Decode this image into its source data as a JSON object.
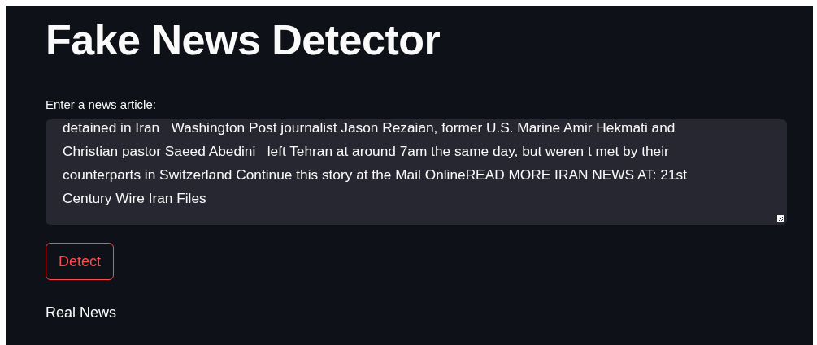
{
  "title": "Fake News Detector",
  "article_field": {
    "label": "Enter a news article:",
    "value": "detained in Iran   Washington Post journalist Jason Rezaian, former U.S. Marine Amir Hekmati and\nChristian pastor Saeed Abedini   left Tehran at around 7am the same day, but weren t met by their\ncounterparts in Switzerland Continue this story at the Mail OnlineREAD MORE IRAN NEWS AT: 21st\nCentury Wire Iran Files"
  },
  "detect_button": {
    "label": "Detect"
  },
  "result": "Real News"
}
